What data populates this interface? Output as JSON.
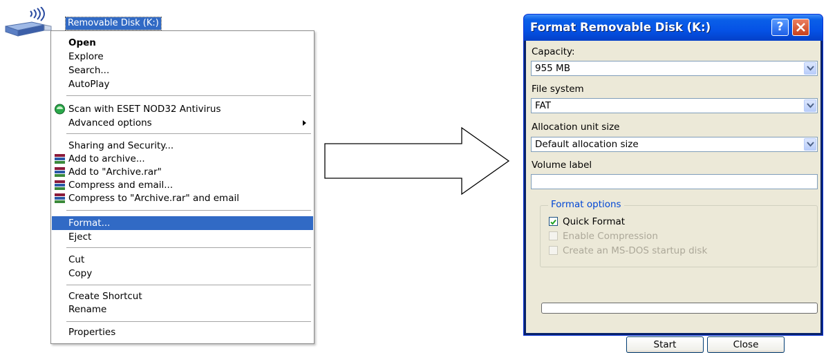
{
  "desktop": {
    "drive_label": "Removable Disk (K:)"
  },
  "context_menu": {
    "items": [
      {
        "label": "Open"
      },
      {
        "label": "Explore"
      },
      {
        "label": "Search..."
      },
      {
        "label": "AutoPlay"
      },
      {
        "label": "Scan with ESET NOD32 Antivirus"
      },
      {
        "label": "Advanced options"
      },
      {
        "label": "Sharing and Security..."
      },
      {
        "label": "Add to archive..."
      },
      {
        "label": "Add to \"Archive.rar\""
      },
      {
        "label": "Compress and email..."
      },
      {
        "label": "Compress to \"Archive.rar\" and email"
      },
      {
        "label": "Format..."
      },
      {
        "label": "Eject"
      },
      {
        "label": "Cut"
      },
      {
        "label": "Copy"
      },
      {
        "label": "Create Shortcut"
      },
      {
        "label": "Rename"
      },
      {
        "label": "Properties"
      }
    ]
  },
  "dialog": {
    "title": "Format Removable Disk (K:)",
    "help_label": "?",
    "capacity_label": "Capacity:",
    "capacity_value": "955 MB",
    "filesystem_label": "File system",
    "filesystem_value": "FAT",
    "allocation_label": "Allocation unit size",
    "allocation_value": "Default allocation size",
    "volume_label": "Volume label",
    "volume_value": "",
    "format_options_title": "Format options",
    "quick_format_label": "Quick Format",
    "quick_format_checked": true,
    "enable_compression_label": "Enable Compression",
    "msdos_label": "Create an MS-DOS startup disk",
    "progress": 0,
    "start_label": "Start",
    "close_label": "Close"
  },
  "colors": {
    "selection": "#316ac5",
    "title_bar": "#0552e6",
    "dialog_bg": "#ece9d8"
  }
}
